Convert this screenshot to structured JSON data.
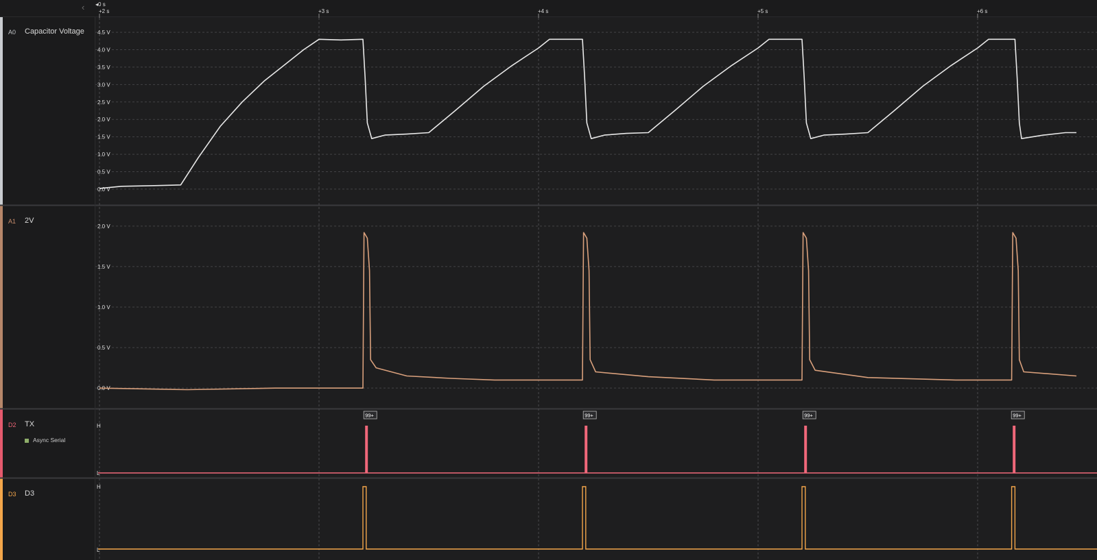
{
  "timeline": {
    "origin_label": "0 s",
    "ticks": [
      {
        "t": 2,
        "label": "+2 s"
      },
      {
        "t": 3,
        "label": "+3 s"
      },
      {
        "t": 4,
        "label": "+4 s"
      },
      {
        "t": 5,
        "label": "+5 s"
      },
      {
        "t": 6,
        "label": "+6 s"
      }
    ],
    "range_s": [
      2,
      6.45
    ]
  },
  "channels": [
    {
      "id": "A0",
      "name": "Capacitor Voltage",
      "type": "analog",
      "color": "#e8e8e8",
      "accent": "#c9ccd0",
      "y_range": [
        -0.1,
        4.6
      ],
      "y_ticks": [
        {
          "v": 4.5,
          "label": "4.5 V"
        },
        {
          "v": 4.0,
          "label": "4.0 V"
        },
        {
          "v": 3.5,
          "label": "3.5 V"
        },
        {
          "v": 3.0,
          "label": "3.0 V"
        },
        {
          "v": 2.5,
          "label": "2.5 V"
        },
        {
          "v": 2.0,
          "label": "2.0 V"
        },
        {
          "v": 1.5,
          "label": "1.5 V"
        },
        {
          "v": 1.0,
          "label": "1.0 V"
        },
        {
          "v": 0.5,
          "label": "0.5 V"
        },
        {
          "v": 0.0,
          "label": "0.0 V"
        }
      ],
      "points": [
        [
          2.0,
          0.02
        ],
        [
          2.1,
          0.08
        ],
        [
          2.25,
          0.1
        ],
        [
          2.37,
          0.12
        ],
        [
          2.45,
          0.9
        ],
        [
          2.55,
          1.8
        ],
        [
          2.65,
          2.5
        ],
        [
          2.75,
          3.1
        ],
        [
          2.85,
          3.6
        ],
        [
          2.93,
          4.0
        ],
        [
          3.0,
          4.3
        ],
        [
          3.1,
          4.28
        ],
        [
          3.2,
          4.3
        ],
        [
          3.21,
          3.2
        ],
        [
          3.22,
          1.9
        ],
        [
          3.24,
          1.45
        ],
        [
          3.3,
          1.55
        ],
        [
          3.4,
          1.58
        ],
        [
          3.5,
          1.62
        ],
        [
          3.62,
          2.25
        ],
        [
          3.75,
          2.95
        ],
        [
          3.88,
          3.55
        ],
        [
          4.0,
          4.05
        ],
        [
          4.05,
          4.3
        ],
        [
          4.15,
          4.3
        ],
        [
          4.2,
          4.3
        ],
        [
          4.21,
          3.2
        ],
        [
          4.22,
          1.9
        ],
        [
          4.24,
          1.45
        ],
        [
          4.3,
          1.55
        ],
        [
          4.4,
          1.6
        ],
        [
          4.5,
          1.62
        ],
        [
          4.62,
          2.25
        ],
        [
          4.75,
          2.95
        ],
        [
          4.88,
          3.55
        ],
        [
          5.0,
          4.05
        ],
        [
          5.05,
          4.3
        ],
        [
          5.15,
          4.3
        ],
        [
          5.2,
          4.3
        ],
        [
          5.21,
          3.2
        ],
        [
          5.22,
          1.9
        ],
        [
          5.24,
          1.45
        ],
        [
          5.3,
          1.55
        ],
        [
          5.4,
          1.58
        ],
        [
          5.5,
          1.62
        ],
        [
          5.62,
          2.25
        ],
        [
          5.75,
          2.95
        ],
        [
          5.88,
          3.55
        ],
        [
          6.0,
          4.05
        ],
        [
          6.05,
          4.3
        ],
        [
          6.12,
          4.3
        ],
        [
          6.17,
          4.3
        ],
        [
          6.18,
          3.2
        ],
        [
          6.19,
          1.9
        ],
        [
          6.2,
          1.45
        ],
        [
          6.3,
          1.55
        ],
        [
          6.4,
          1.62
        ],
        [
          6.45,
          1.62
        ]
      ]
    },
    {
      "id": "A1",
      "name": "2V",
      "type": "analog",
      "color": "#d9a07c",
      "accent": "#b68669",
      "y_range": [
        -0.1,
        2.1
      ],
      "y_ticks": [
        {
          "v": 2.0,
          "label": "2.0 V"
        },
        {
          "v": 1.5,
          "label": "1.5 V"
        },
        {
          "v": 1.0,
          "label": "1.0 V"
        },
        {
          "v": 0.5,
          "label": "0.5 V"
        },
        {
          "v": 0.0,
          "label": "0.0 V"
        }
      ],
      "points": [
        [
          2.0,
          0.0
        ],
        [
          2.4,
          -0.02
        ],
        [
          2.8,
          0.0
        ],
        [
          3.2,
          0.0
        ],
        [
          3.205,
          1.92
        ],
        [
          3.22,
          1.85
        ],
        [
          3.23,
          1.45
        ],
        [
          3.235,
          0.35
        ],
        [
          3.26,
          0.25
        ],
        [
          3.4,
          0.15
        ],
        [
          3.6,
          0.12
        ],
        [
          3.8,
          0.1
        ],
        [
          4.2,
          0.1
        ],
        [
          4.205,
          1.92
        ],
        [
          4.22,
          1.85
        ],
        [
          4.23,
          1.45
        ],
        [
          4.235,
          0.35
        ],
        [
          4.26,
          0.2
        ],
        [
          4.5,
          0.14
        ],
        [
          4.8,
          0.1
        ],
        [
          5.2,
          0.1
        ],
        [
          5.205,
          1.92
        ],
        [
          5.22,
          1.85
        ],
        [
          5.23,
          1.45
        ],
        [
          5.235,
          0.35
        ],
        [
          5.26,
          0.22
        ],
        [
          5.5,
          0.13
        ],
        [
          5.9,
          0.1
        ],
        [
          6.155,
          0.1
        ],
        [
          6.16,
          1.92
        ],
        [
          6.175,
          1.85
        ],
        [
          6.185,
          1.45
        ],
        [
          6.19,
          0.35
        ],
        [
          6.21,
          0.2
        ],
        [
          6.45,
          0.15
        ]
      ]
    },
    {
      "id": "D2",
      "name": "TX",
      "type": "digital",
      "color": "#f0687a",
      "accent": "#e55a6d",
      "analyzer": "Async Serial",
      "levels": {
        "high": "H",
        "low": "L"
      },
      "bursts": [
        3.21,
        4.21,
        5.21,
        6.16
      ],
      "burst_width_s": 0.012,
      "badge": "99+"
    },
    {
      "id": "D3",
      "name": "D3",
      "type": "digital",
      "color": "#f4a64a",
      "accent": "#f4a64a",
      "levels": {
        "high": "H",
        "low": "L"
      },
      "pulses": [
        [
          3.2,
          3.215
        ],
        [
          4.2,
          4.215
        ],
        [
          5.2,
          5.215
        ],
        [
          6.155,
          6.17
        ]
      ]
    }
  ]
}
